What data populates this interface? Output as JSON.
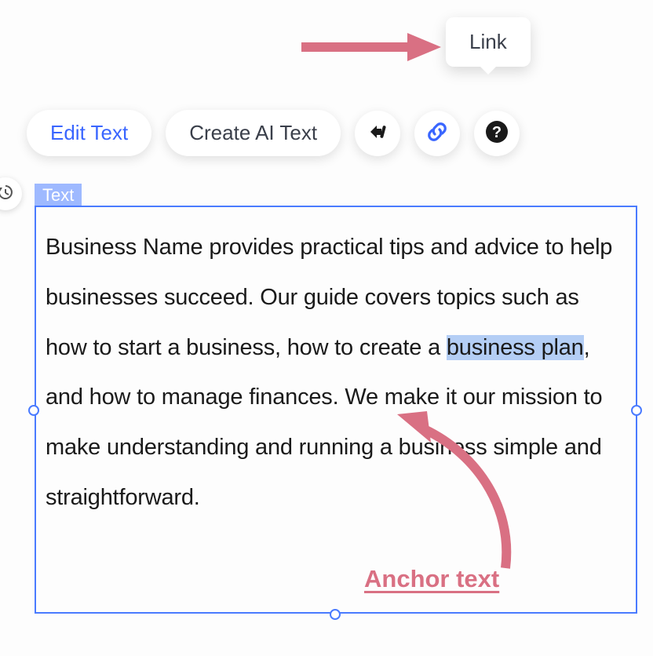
{
  "tooltip": {
    "label": "Link"
  },
  "toolbar": {
    "edit_label": "Edit Text",
    "create_ai_label": "Create AI Text"
  },
  "element": {
    "type_label": "Text",
    "body_before": "Business Name provides practical tips and advice to help businesses succeed. Our guide covers topics such as how to start a business, how to create a ",
    "body_highlight": "business plan",
    "body_after": ", and how to manage finances. We make it our mission to make understanding and running a business simple and straightforward."
  },
  "annotation": {
    "label": "Anchor text"
  },
  "colors": {
    "accent": "#4a7bff",
    "annotation": "#d97083",
    "highlight": "#b4cef5"
  }
}
